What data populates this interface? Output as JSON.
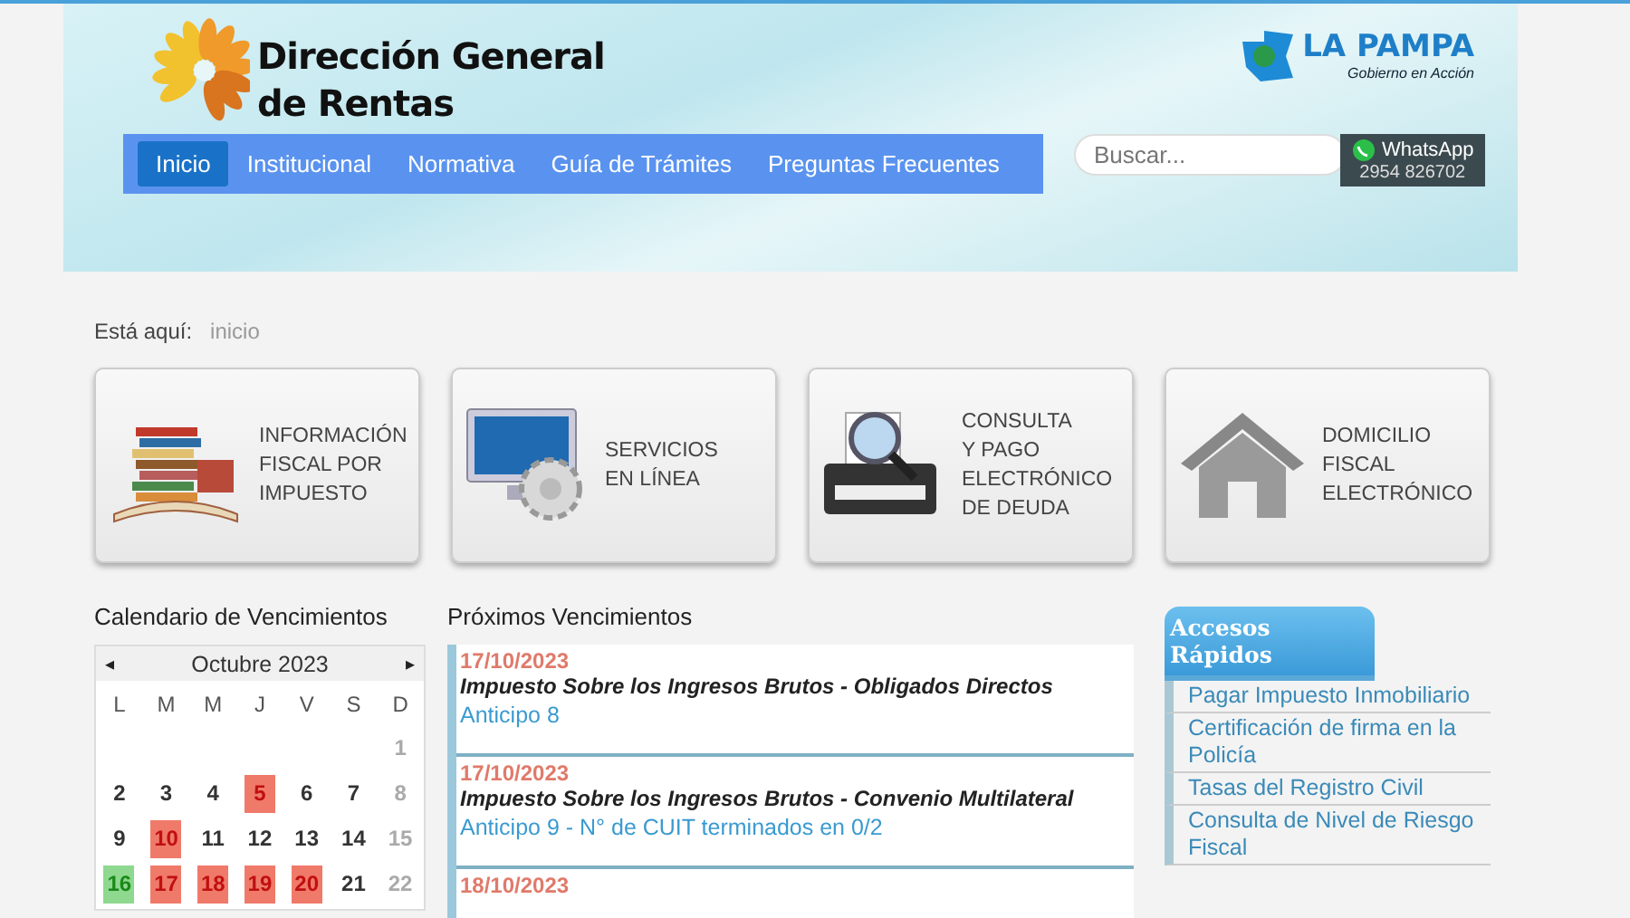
{
  "header": {
    "title_line_1": "Dirección General",
    "title_line_2": "de Rentas",
    "gov_logo": {
      "name": "LA PAMPA",
      "tagline": "Gobierno en Acción"
    }
  },
  "nav": [
    {
      "label": "Inicio",
      "selected": true
    },
    {
      "label": "Institucional",
      "selected": false
    },
    {
      "label": "Normativa",
      "selected": false
    },
    {
      "label": "Guía de Trámites",
      "selected": false
    },
    {
      "label": "Preguntas Frecuentes",
      "selected": false
    }
  ],
  "search": {
    "placeholder": "Buscar..."
  },
  "whatsapp": {
    "label": "WhatsApp",
    "phone": "2954 826702"
  },
  "breadcrumb": {
    "label": "Está aquí:",
    "current": "inicio"
  },
  "tiles": [
    {
      "kind": "books",
      "lines": [
        "INFORMACIÓN",
        "FISCAL POR",
        "IMPUESTO"
      ]
    },
    {
      "kind": "computer",
      "lines": [
        "SERVICIOS",
        "EN LÍNEA"
      ]
    },
    {
      "kind": "printer",
      "lines": [
        "CONSULTA",
        "Y PAGO",
        "ELECTRÓNICO",
        "DE DEUDA"
      ]
    },
    {
      "kind": "house",
      "lines": [
        "DOMICILIO",
        "FISCAL",
        "ELECTRÓNICO"
      ]
    }
  ],
  "calendar": {
    "title": "Calendario de Vencimientos",
    "prev": "◂",
    "month": "Octubre 2023",
    "next": "▸",
    "weekdays": [
      "L",
      "M",
      "M",
      "J",
      "V",
      "S",
      "D"
    ],
    "weeks": [
      [
        {
          "kind": "empty"
        },
        {
          "kind": "empty"
        },
        {
          "kind": "empty"
        },
        {
          "kind": "empty"
        },
        {
          "kind": "empty"
        },
        {
          "kind": "empty"
        },
        {
          "day": "1",
          "kind": "weekend"
        }
      ],
      [
        {
          "day": "2",
          "kind": "plain"
        },
        {
          "day": "3",
          "kind": "plain"
        },
        {
          "day": "4",
          "kind": "plain"
        },
        {
          "day": "5",
          "kind": "due"
        },
        {
          "day": "6",
          "kind": "plain"
        },
        {
          "day": "7",
          "kind": "plain"
        },
        {
          "day": "8",
          "kind": "weekend"
        }
      ],
      [
        {
          "day": "9",
          "kind": "plain"
        },
        {
          "day": "10",
          "kind": "due"
        },
        {
          "day": "11",
          "kind": "plain"
        },
        {
          "day": "12",
          "kind": "plain"
        },
        {
          "day": "13",
          "kind": "plain"
        },
        {
          "day": "14",
          "kind": "plain"
        },
        {
          "day": "15",
          "kind": "weekend"
        }
      ],
      [
        {
          "day": "16",
          "kind": "today"
        },
        {
          "day": "17",
          "kind": "due"
        },
        {
          "day": "18",
          "kind": "due"
        },
        {
          "day": "19",
          "kind": "due"
        },
        {
          "day": "20",
          "kind": "due"
        },
        {
          "day": "21",
          "kind": "plain"
        },
        {
          "day": "22",
          "kind": "weekend"
        }
      ]
    ]
  },
  "upcoming": {
    "title": "Próximos Vencimientos",
    "items": [
      {
        "date": "17/10/2023",
        "tax": "Impuesto Sobre los Ingresos Brutos - Obligados Directos",
        "detail": "Anticipo 8"
      },
      {
        "date": "17/10/2023",
        "tax": "Impuesto Sobre los Ingresos Brutos - Convenio Multilateral",
        "detail": "Anticipo 9 - N° de CUIT terminados en 0/2"
      },
      {
        "date": "18/10/2023"
      }
    ]
  },
  "quick_access": {
    "title": "Accesos Rápidos",
    "items": [
      "Pagar Impuesto Inmobiliario",
      "Certificación de firma en la Policía",
      "Tasas del Registro Civil",
      "Consulta de Nivel de Riesgo Fiscal"
    ]
  }
}
